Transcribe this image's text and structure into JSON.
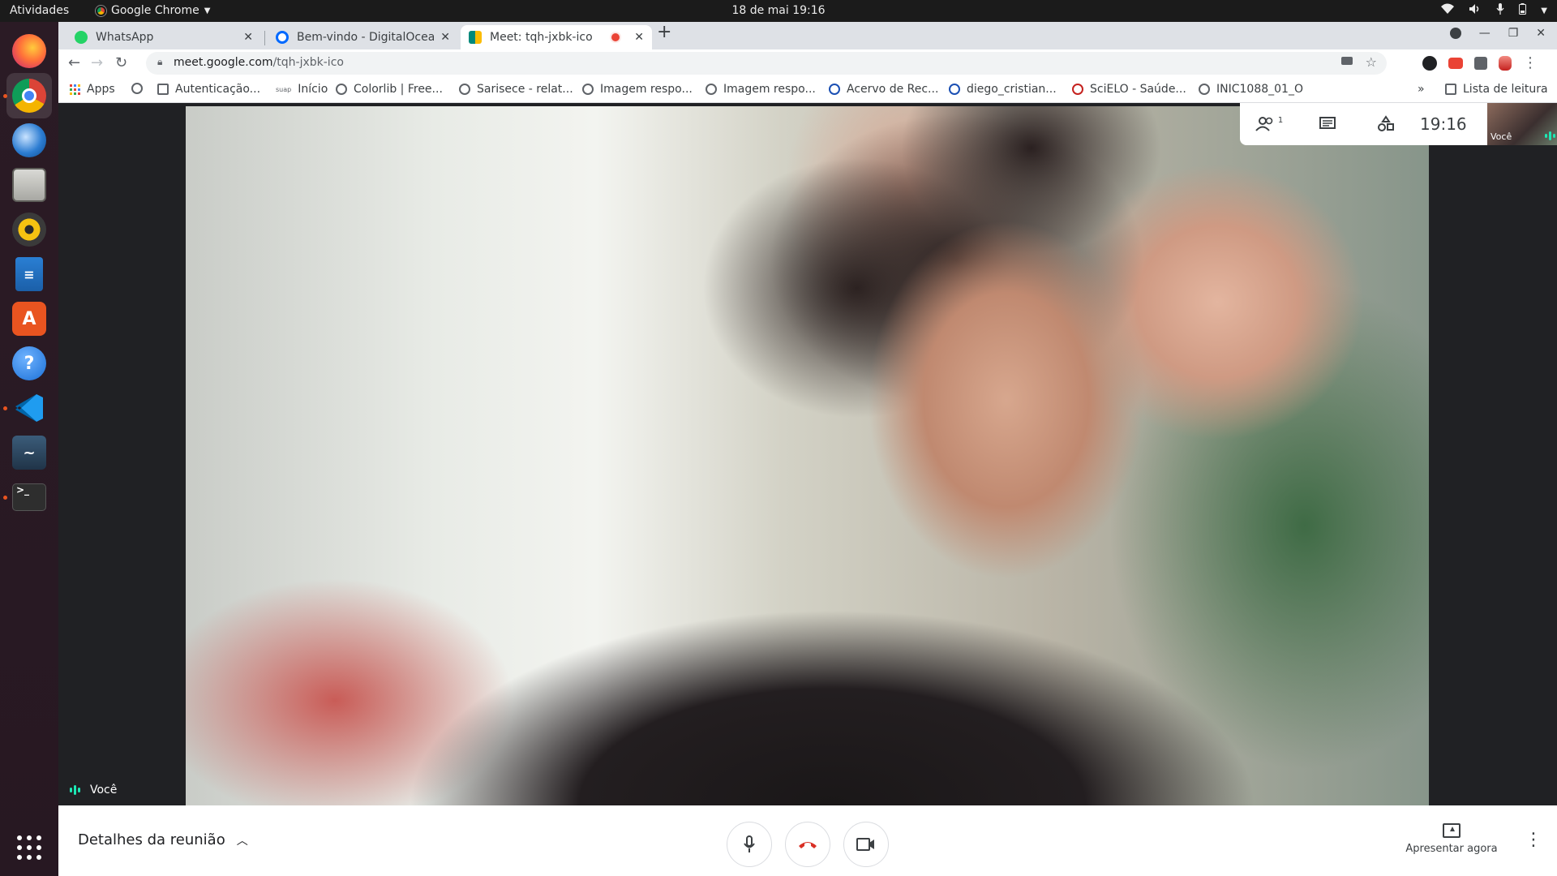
{
  "topbar": {
    "activities": "Atividades",
    "app_name": "Google Chrome",
    "datetime": "18 de mai  19:16"
  },
  "dock": {
    "items": [
      "firefox-icon",
      "chrome-icon",
      "thunderbird-icon",
      "files-icon",
      "rhythmbox-icon",
      "writer-icon",
      "software-icon",
      "help-icon",
      "vscode-icon",
      "mysql-workbench-icon",
      "terminal-icon",
      "apps-grid-icon"
    ]
  },
  "browser": {
    "tabs": [
      {
        "title": "WhatsApp",
        "color": "#25d366"
      },
      {
        "title": "Bem-vindo - DigitalOcean",
        "color": "#0069ff"
      },
      {
        "title": "Meet: tqh-jxbk-ico",
        "color": "#00897b"
      }
    ],
    "url_host": "meet.google.com",
    "url_path": "/tqh-jxbk-ico",
    "bookmarks": [
      "Apps",
      "Autenticação...",
      "Início",
      "Colorlib | Free...",
      "Sarisece - relat...",
      "Imagem respo...",
      "Imagem respo...",
      "Acervo de Rec...",
      "diego_cristian...",
      "SciELO - Saúde...",
      "INIC1088_01_O"
    ],
    "reading_list": "Lista de leitura",
    "overflow": "»"
  },
  "meet": {
    "self_label": "Você",
    "time": "19:16",
    "people_count": "1",
    "selftile_label": "Você",
    "details_label": "Detalhes da reunião",
    "present_label": "Apresentar agora",
    "accent_color": "#1ce8b5",
    "hangup_color": "#d93025"
  }
}
